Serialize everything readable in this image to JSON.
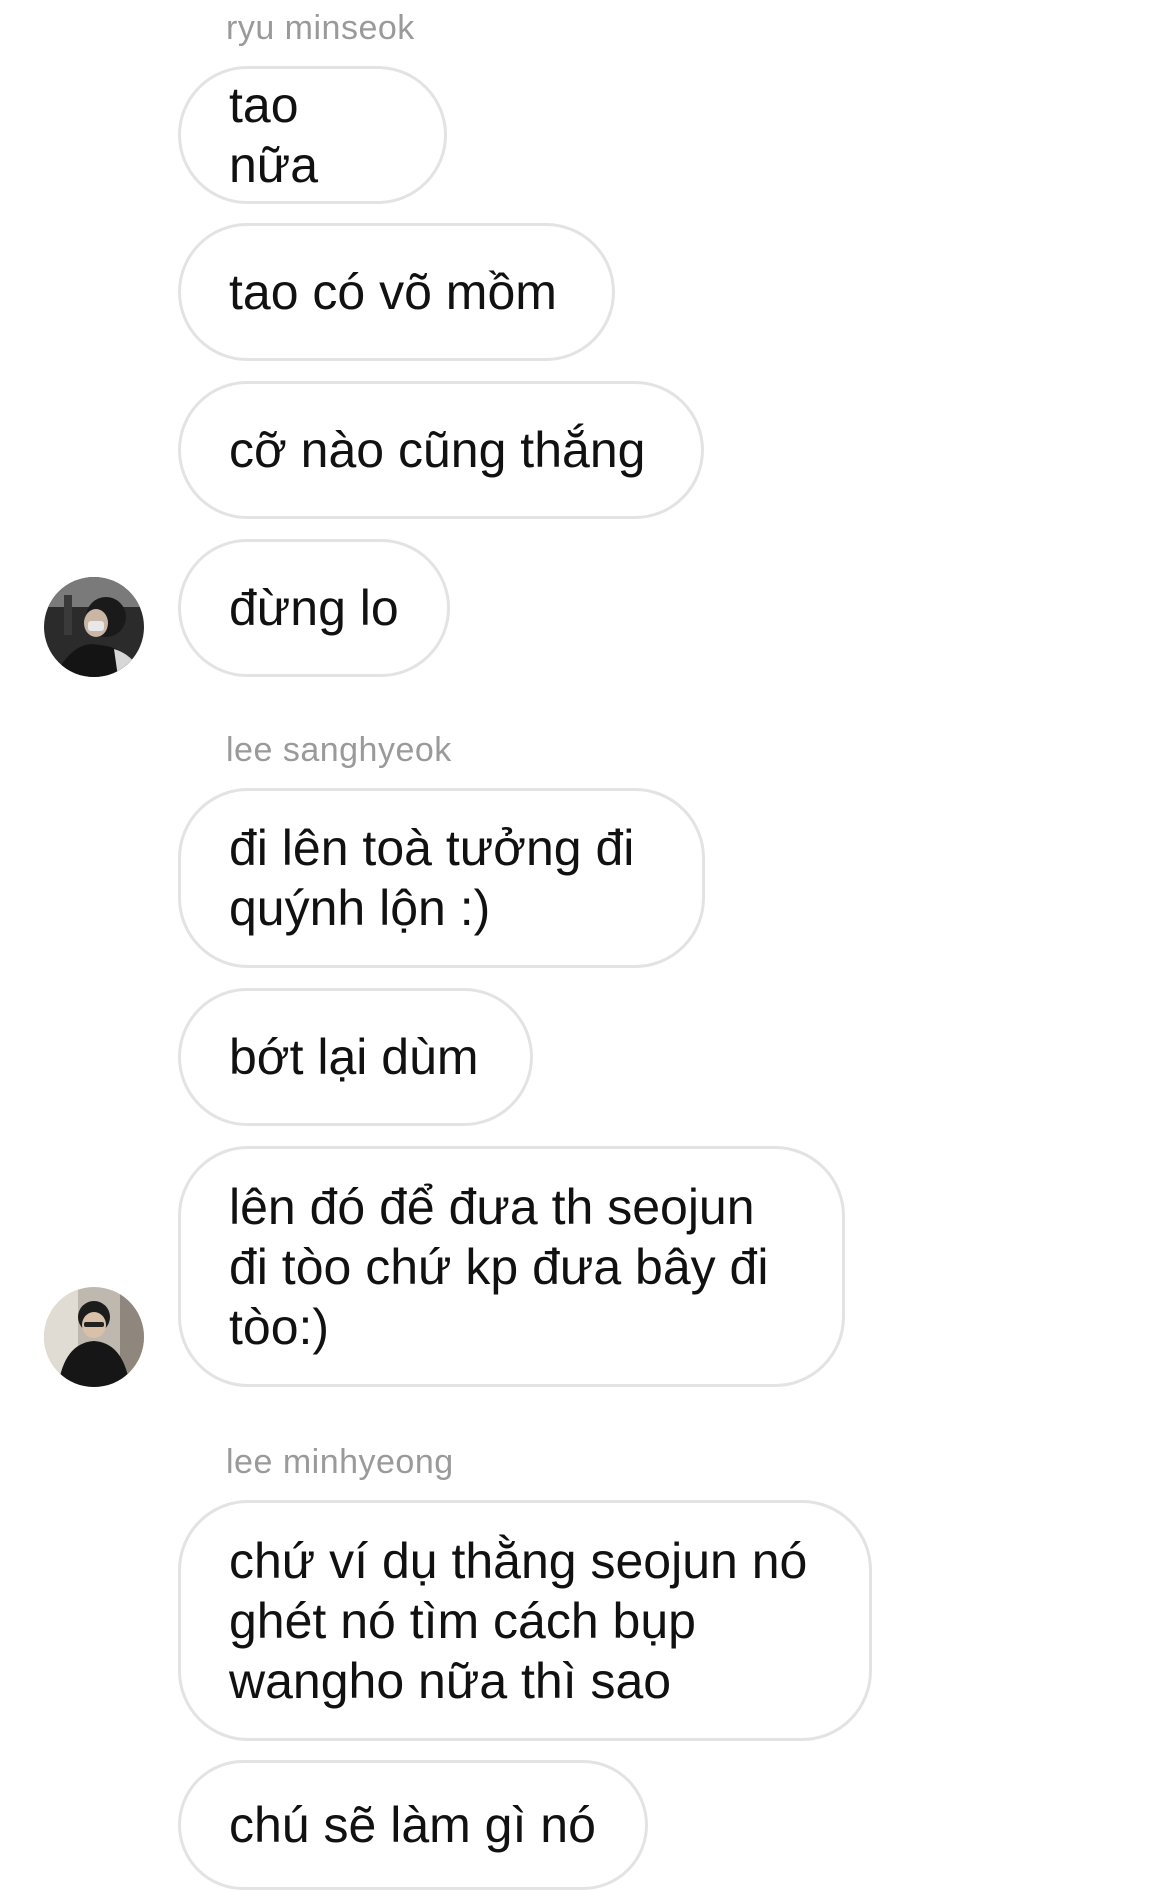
{
  "groups": [
    {
      "sender": "ryu minseok",
      "avatar": "profile-photo",
      "messages": [
        "tao nữa",
        "tao có võ mồm",
        "cỡ nào cũng thắng",
        "đừng lo"
      ]
    },
    {
      "sender": "lee sanghyeok",
      "avatar": "profile-photo",
      "messages": [
        "đi lên toà tưởng đi\nquýnh lộn :)",
        "bớt lại dùm",
        "lên đó để đưa th seojun\nđi tòo chứ kp đưa bây đi\ntòo:)"
      ]
    },
    {
      "sender": "lee minhyeong",
      "messages": [
        "chứ ví dụ thằng seojun nó\nghét nó tìm cách bụp\nwangho nữa thì sao",
        "chú sẽ làm gì nó"
      ]
    }
  ]
}
